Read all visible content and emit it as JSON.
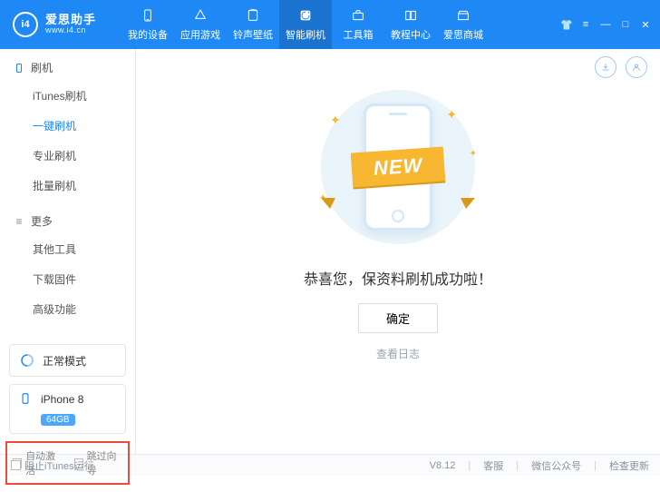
{
  "logo": {
    "badge": "i4",
    "title": "爱思助手",
    "subtitle": "www.i4.cn"
  },
  "nav": {
    "items": [
      {
        "label": "我的设备"
      },
      {
        "label": "应用游戏"
      },
      {
        "label": "铃声壁纸"
      },
      {
        "label": "智能刷机"
      },
      {
        "label": "工具箱"
      },
      {
        "label": "教程中心"
      },
      {
        "label": "爱思商城"
      }
    ],
    "activeIndex": 3
  },
  "sidebar": {
    "group1": {
      "title": "刷机",
      "items": [
        "iTunes刷机",
        "一键刷机",
        "专业刷机",
        "批量刷机"
      ],
      "activeIndex": 1
    },
    "group2": {
      "title": "更多",
      "items": [
        "其他工具",
        "下载固件",
        "高级功能"
      ]
    },
    "mode": {
      "label": "正常模式"
    },
    "device": {
      "name": "iPhone 8",
      "storage": "64GB"
    },
    "checks": {
      "autoActivate": "自动激活",
      "skipGuide": "跳过向导"
    }
  },
  "main": {
    "ribbon": "NEW",
    "message": "恭喜您，保资料刷机成功啦！",
    "okButton": "确定",
    "logLink": "查看日志"
  },
  "statusbar": {
    "blockItunes": "阻止iTunes运行",
    "version": "V8.12",
    "support": "客服",
    "wechat": "微信公众号",
    "update": "检查更新"
  }
}
